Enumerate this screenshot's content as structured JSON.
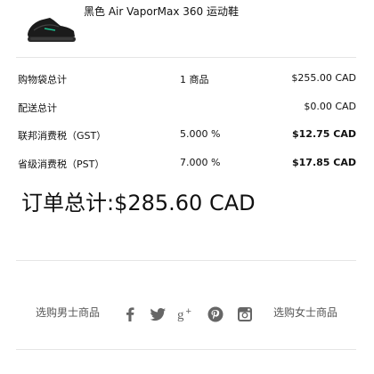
{
  "product": {
    "name": "黑色 Air VaporMax 360 运动鞋",
    "image_icon": "sneaker-image"
  },
  "summary": {
    "rows": [
      {
        "label": "购物袋总计",
        "middle": "1 商品",
        "amount": "$255.00 CAD",
        "bold": false
      },
      {
        "label": "配送总计",
        "middle": "",
        "amount": "$0.00 CAD",
        "bold": false
      },
      {
        "label": "联邦消费税（GST）",
        "middle": "5.000 %",
        "amount": "$12.75 CAD",
        "bold": true
      },
      {
        "label": "省级消费税（PST）",
        "middle": "7.000 %",
        "amount": "$17.85 CAD",
        "bold": true
      }
    ],
    "grand_total": "订单总计:$285.60 CAD"
  },
  "footer": {
    "shop_men": "选购男士商品",
    "shop_women": "选购女士商品",
    "social_icons": [
      "facebook-icon",
      "twitter-icon",
      "google-plus-icon",
      "pinterest-icon",
      "instagram-icon"
    ]
  },
  "colors": {
    "text": "#111111",
    "muted": "#555555",
    "icon": "#666666",
    "divider": "#e5e5e5",
    "swoosh_accent": "#1fbf8f"
  }
}
